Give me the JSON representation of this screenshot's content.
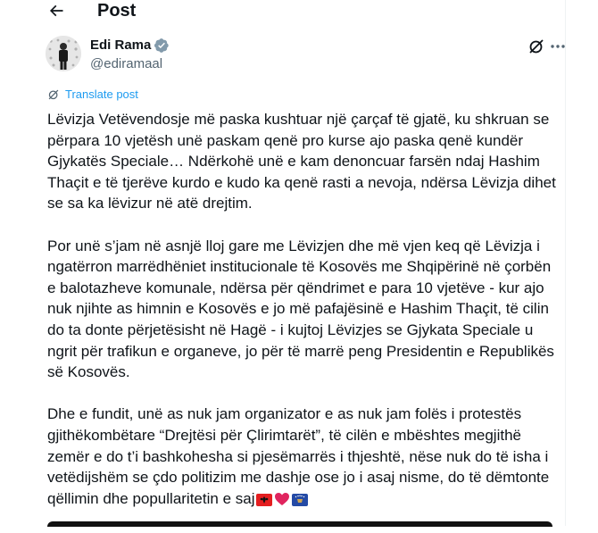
{
  "header": {
    "title": "Post"
  },
  "author": {
    "name": "Edi Rama",
    "handle": "@ediramaal"
  },
  "translate_label": "Translate post",
  "post": {
    "p1": "Lëvizja Vetëvendosje më paska kushtuar një çarçaf të gjatë, ku shkruan se përpara 10 vjetësh unë paskam qenë pro kurse ajo paska qenë kundër Gjykatës Speciale… Ndërkohë unë e kam denoncuar farsën ndaj Hashim Thaçit e të tjerëve kurdo e kudo ka qenë rasti a nevoja, ndërsa Lëvizja dihet se sa ka lëvizur në atë drejtim.",
    "p2": "Por unë s’jam në asnjë lloj gare me Lëvizjen dhe më vjen keq që Lëvizja i ngatërron marrëdhëniet institucionale të Kosovës me Shqipërinë në çorbën e balotazheve komunale, ndërsa për qëndrimet e para 10 vjetëve - kur ajo nuk njihte as himnin e Kosovës e jo më pafajësinë e Hashim Thaçit, të cilin do ta donte përjetësisht në Hagë - i kujtoj Lëvizjes se Gjykata Speciale u ngrit për trafikun e organeve, jo për të marrë peng Presidentin e Republikës së Kosovës.",
    "p3": "Dhe e fundit, unë as nuk jam organizator e as nuk jam folës i  protestës gjithëkombëtare “Drejtësi për Çlirimtarët”, të cilën e mbështes megjithë zemër e do t’i bashkohesha si pjesëmarrës i thjeshtë, nëse nuk do të isha i vetëdijshëm se çdo politizim me dashje ose jo i asaj nisme, do të dëmtonte qëllimin dhe popullaritetin e saj"
  },
  "icons": {
    "back": "arrow-left-icon",
    "verified": "verified-badge-icon",
    "grok": "grok-icon",
    "more": "more-horizontal-icon",
    "translate": "translate-icon",
    "emoji": [
      "flag-albania-emoji",
      "red-heart-emoji",
      "flag-kosovo-emoji"
    ]
  },
  "colors": {
    "accent": "#1d9bf0",
    "text": "#0f1419",
    "muted": "#536471"
  }
}
